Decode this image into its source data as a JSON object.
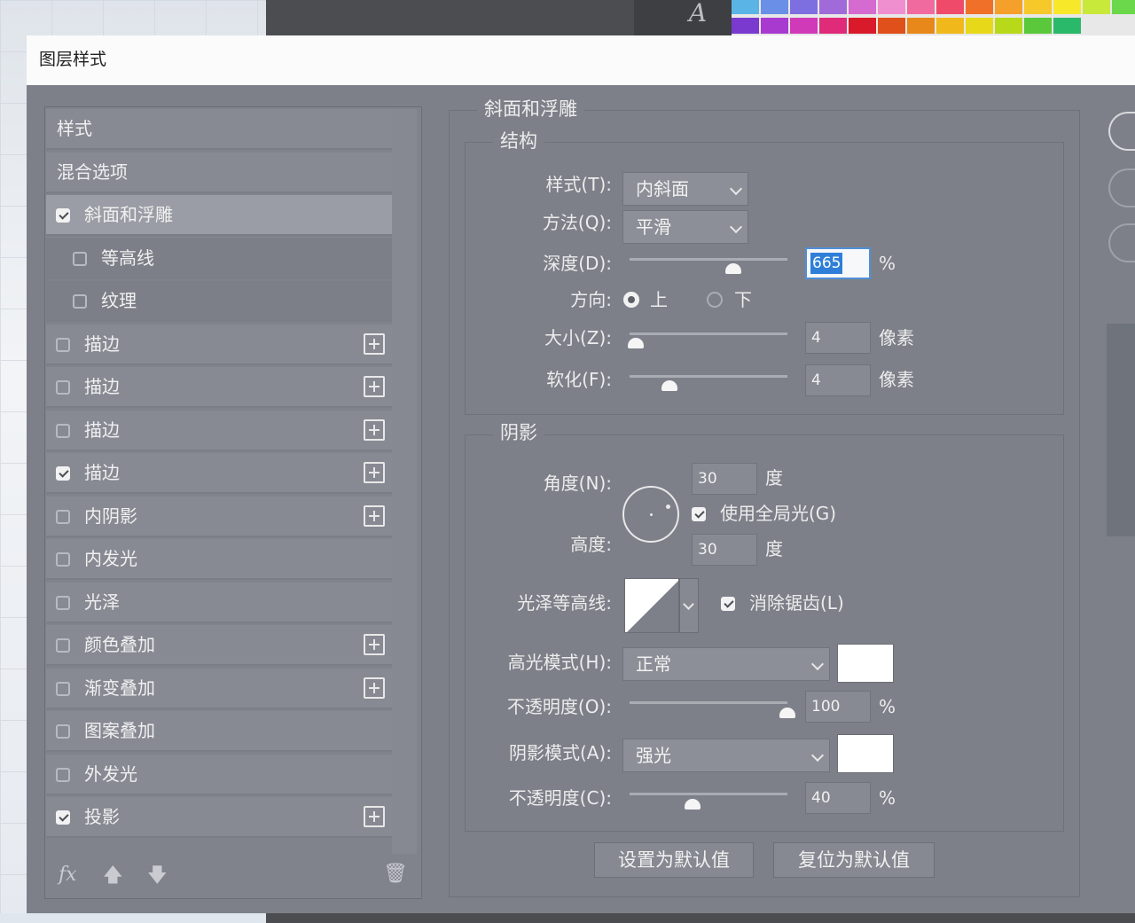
{
  "background": {
    "type_tool_glyph": "A",
    "swatch_colors_row1": [
      "#5ab4e6",
      "#6a8fe6",
      "#7d6fe0",
      "#a06ad8",
      "#d56ad0",
      "#f08fd0",
      "#f06aa0",
      "#f04a6a",
      "#f0702a",
      "#f4a02a",
      "#f6c82a",
      "#f8e82a",
      "#c8e83a",
      "#6ad84a"
    ],
    "swatch_colors_row2": [
      "#7a3ad0",
      "#a83ad0",
      "#d03ab8",
      "#e02a7a",
      "#d81a2a",
      "#e0501a",
      "#e8881a",
      "#f0b81a",
      "#e8d81a",
      "#b8d81a",
      "#5ac83a",
      "#2ab86a"
    ]
  },
  "dialog": {
    "title": "图层样式",
    "styles_panel": {
      "items": [
        {
          "label": "样式",
          "checkbox": null,
          "add": false,
          "state": "header"
        },
        {
          "label": "混合选项",
          "checkbox": null,
          "add": false,
          "state": "header"
        },
        {
          "label": "斜面和浮雕",
          "checkbox": true,
          "add": false,
          "state": "selected"
        },
        {
          "label": "等高线",
          "checkbox": false,
          "add": false,
          "state": "sub"
        },
        {
          "label": "纹理",
          "checkbox": false,
          "add": false,
          "state": "sub"
        },
        {
          "label": "描边",
          "checkbox": false,
          "add": true,
          "state": "normal"
        },
        {
          "label": "描边",
          "checkbox": false,
          "add": true,
          "state": "normal"
        },
        {
          "label": "描边",
          "checkbox": false,
          "add": true,
          "state": "normal"
        },
        {
          "label": "描边",
          "checkbox": true,
          "add": true,
          "state": "normal"
        },
        {
          "label": "内阴影",
          "checkbox": false,
          "add": true,
          "state": "normal"
        },
        {
          "label": "内发光",
          "checkbox": false,
          "add": false,
          "state": "normal"
        },
        {
          "label": "光泽",
          "checkbox": false,
          "add": false,
          "state": "normal"
        },
        {
          "label": "颜色叠加",
          "checkbox": false,
          "add": true,
          "state": "normal"
        },
        {
          "label": "渐变叠加",
          "checkbox": false,
          "add": true,
          "state": "normal"
        },
        {
          "label": "图案叠加",
          "checkbox": false,
          "add": false,
          "state": "normal"
        },
        {
          "label": "外发光",
          "checkbox": false,
          "add": false,
          "state": "normal"
        },
        {
          "label": "投影",
          "checkbox": true,
          "add": true,
          "state": "normal"
        }
      ],
      "footer": {
        "fx": "fx",
        "up_icon": "arrow-up-icon",
        "down_icon": "arrow-down-icon",
        "delete_icon": "trash-icon"
      }
    },
    "bevel": {
      "section_title": "斜面和浮雕",
      "structure": {
        "title": "结构",
        "style_label": "样式(T):",
        "style_value": "内斜面",
        "technique_label": "方法(Q):",
        "technique_value": "平滑",
        "depth_label": "深度(D):",
        "depth_value": "665",
        "depth_unit": "%",
        "depth_slider_fraction": 0.66,
        "direction_label": "方向:",
        "direction_up": "上",
        "direction_down": "下",
        "direction_selected": "上",
        "size_label": "大小(Z):",
        "size_value": "4",
        "size_unit": "像素",
        "size_slider_fraction": 0.04,
        "soften_label": "软化(F):",
        "soften_value": "4",
        "soften_unit": "像素",
        "soften_slider_fraction": 0.25
      },
      "shading": {
        "title": "阴影",
        "angle_label": "角度(N):",
        "angle_value": "30",
        "angle_unit": "度",
        "use_global_light_label": "使用全局光(G)",
        "use_global_light": true,
        "altitude_label": "高度:",
        "altitude_value": "30",
        "altitude_unit": "度",
        "gloss_contour_label": "光泽等高线:",
        "anti_aliased_label": "消除锯齿(L)",
        "anti_aliased": true,
        "highlight_mode_label": "高光模式(H):",
        "highlight_mode_value": "正常",
        "highlight_color": "#ffffff",
        "highlight_opacity_label": "不透明度(O):",
        "highlight_opacity_value": "100",
        "highlight_opacity_unit": "%",
        "highlight_opacity_fraction": 1.0,
        "shadow_mode_label": "阴影模式(A):",
        "shadow_mode_value": "强光",
        "shadow_color": "#ffffff",
        "shadow_opacity_label": "不透明度(C):",
        "shadow_opacity_value": "40",
        "shadow_opacity_unit": "%",
        "shadow_opacity_fraction": 0.4
      },
      "buttons": {
        "make_default": "设置为默认值",
        "reset_default": "复位为默认值"
      }
    }
  }
}
